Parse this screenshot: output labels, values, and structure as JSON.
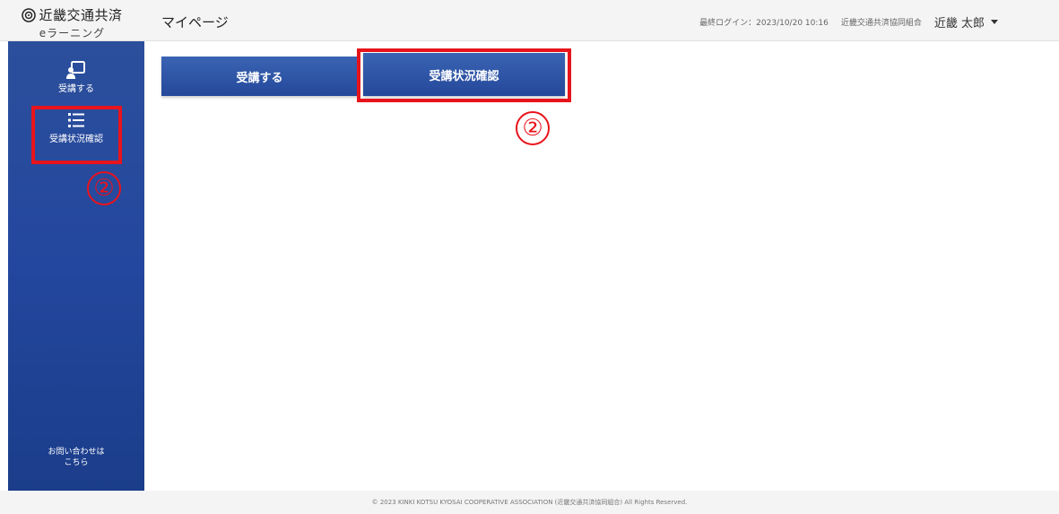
{
  "brand": {
    "name": "近畿交通共済",
    "sub": "eラーニング"
  },
  "header": {
    "page_title": "マイページ",
    "last_login": "最終ログイン：2023/10/20 10:16",
    "org_name": "近畿交通共済協同組合",
    "user_name": "近畿 太郎"
  },
  "sidebar": {
    "items": [
      {
        "label": "受講する",
        "icon": "presentation-icon"
      },
      {
        "label": "受講状況確認",
        "icon": "list-icon"
      }
    ],
    "contact": {
      "line1": "お問い合わせは",
      "line2": "こちら"
    }
  },
  "main": {
    "buttons": [
      {
        "label": "受講する"
      },
      {
        "label": "受講状況確認"
      }
    ]
  },
  "annotations": {
    "marker": "②",
    "color": "#e8141c"
  },
  "colors": {
    "sidebar": "#23479e",
    "button": "#2b4e9f",
    "highlight": "#e8141c"
  },
  "footer": {
    "copyright": "© 2023 KINKI KOTSU KYOSAI COOPERATIVE ASSOCIATION (近畿交通共済協同組合) All Rights Reserved."
  }
}
